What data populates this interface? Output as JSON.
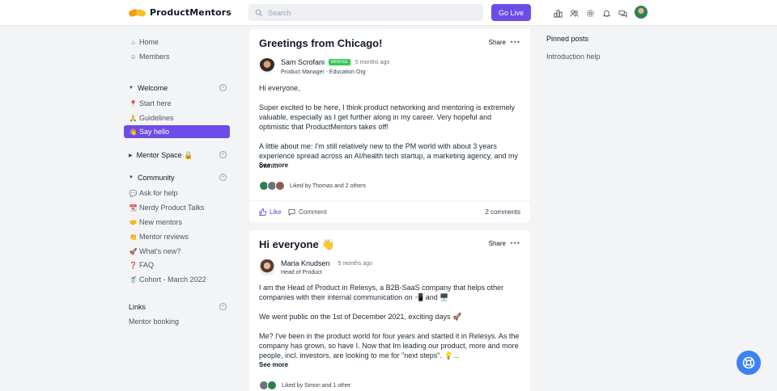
{
  "brand": {
    "name": "ProductMentors"
  },
  "search": {
    "placeholder": "Search"
  },
  "header": {
    "go_live_label": "Go Live"
  },
  "top_icons": [
    "leaderboard-icon",
    "members-icon",
    "settings-icon",
    "notifications-icon",
    "messages-icon"
  ],
  "sidebar": {
    "top_items": [
      {
        "label": "Home",
        "icon": "home-icon"
      },
      {
        "label": "Members",
        "icon": "members-icon"
      }
    ],
    "sections": [
      {
        "label": "Welcome",
        "items": [
          {
            "emoji": "📍",
            "label": "Start here"
          },
          {
            "emoji": "🙏",
            "label": "Guidelines"
          },
          {
            "emoji": "👋",
            "label": "Say hello",
            "active": true
          }
        ]
      },
      {
        "label": "Mentor Space 🔒",
        "items": []
      },
      {
        "label": "Community",
        "items": [
          {
            "emoji": "💬",
            "label": "Ask for help"
          },
          {
            "emoji": "📆",
            "label": "Nerdy Product Talks"
          },
          {
            "emoji": "🤝",
            "label": "New mentors"
          },
          {
            "emoji": "👏",
            "label": "Mentor reviews"
          },
          {
            "emoji": "🚀",
            "label": "What's new?"
          },
          {
            "emoji": "❓",
            "label": "FAQ"
          },
          {
            "emoji": "🥤",
            "label": "Cohort - March 2022"
          }
        ]
      },
      {
        "label": "Links",
        "items": [
          {
            "emoji": "",
            "label": "Mentor booking"
          }
        ]
      }
    ]
  },
  "posts": [
    {
      "title": "Greetings from Chicago!",
      "share_label": "Share",
      "author": "Sam Scrofani",
      "badge": "MENTEE",
      "time": "5 months ago",
      "role": "Product Manager - Education Org",
      "paragraphs": [
        "Hi everyone,",
        "Super excited to be here, I think product networking and mentoring is extremely valuable, especially as I get further along in my career. Very hopeful and optimistic that ProductMentors takes off!",
        "A little about me: I'm still relatively new to the PM world with about 3 years experience spread across an AI/health tech startup, a marketing agency, and my own..."
      ],
      "see_more": "See more",
      "liked_by": "Liked by Thomas and 2 others",
      "like_label": "Like",
      "comment_label": "Comment",
      "comments_count": "2 comments"
    },
    {
      "title": "Hi everyone 👋",
      "share_label": "Share",
      "author": "Maria Knudsen",
      "time": "5 months ago",
      "role": "Head of Product",
      "paragraphs": [
        "I am the Head of Product in Relesys, a B2B-SaaS company that helps other companies with their internal communication on 📲 and 🖥️",
        "We went public on the 1st of December 2021, exciting days 🚀",
        "Me? I've been in the product world for four years and started it in Relesys. As the company has grown, so have I. Now that Im leading our product, more and more people, incl. investors, are looking to me for \"next steps\". 💡..."
      ],
      "see_more": "See more",
      "liked_by": "Liked by Simon and 1 other"
    }
  ],
  "right": {
    "pinned_heading": "Pinned posts",
    "pinned_items": [
      "Introduction help"
    ]
  },
  "colors": {
    "accent": "#6d4ce8",
    "mentee_badge": "#34c759",
    "support_bubble": "#3b82f6"
  }
}
